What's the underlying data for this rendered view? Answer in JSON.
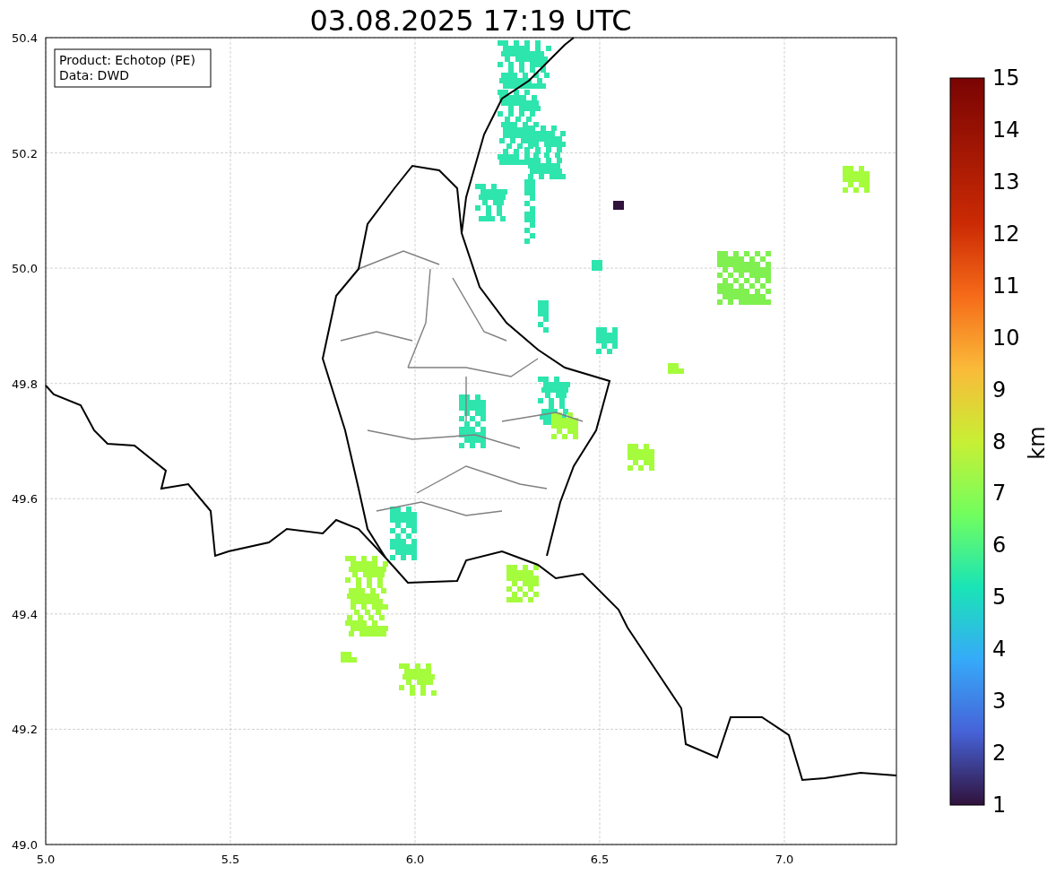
{
  "title": "03.08.2025 17:19 UTC",
  "info_box": {
    "lines": [
      "Product: Echotop (PE)",
      "Data: DWD"
    ]
  },
  "map": {
    "xticks": [
      "5.0",
      "5.5",
      "6.0",
      "6.5",
      "7.0"
    ],
    "yticks": [
      "50.4",
      "50.2",
      "50.0",
      "49.8",
      "49.6",
      "49.4",
      "49.2",
      "49.0"
    ]
  },
  "colorbar": {
    "label": "km",
    "ticks": [
      "15",
      "14",
      "13",
      "12",
      "11",
      "10",
      "9",
      "8",
      "7",
      "6",
      "5",
      "4",
      "3",
      "2",
      "1"
    ]
  }
}
